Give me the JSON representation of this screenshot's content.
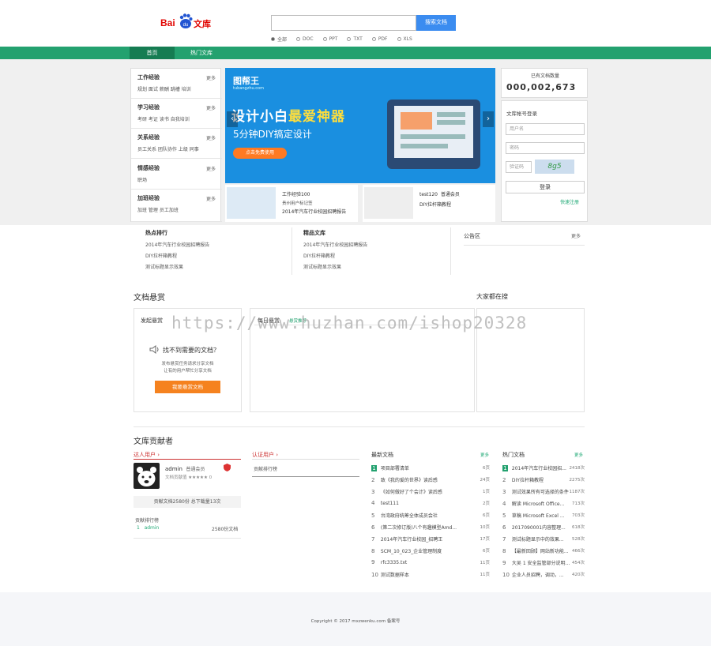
{
  "header": {
    "logo_bai": "Bai",
    "logo_du": "du",
    "logo_wenku": "文库",
    "search_placeholder": "",
    "search_button": "搜索文档",
    "filters": [
      {
        "label": "全部",
        "selected": true
      },
      {
        "label": "DOC",
        "selected": false
      },
      {
        "label": "PPT",
        "selected": false
      },
      {
        "label": "TXT",
        "selected": false
      },
      {
        "label": "PDF",
        "selected": false
      },
      {
        "label": "XLS",
        "selected": false
      }
    ]
  },
  "nav": {
    "items": [
      "首页",
      "热门文库"
    ]
  },
  "categories": [
    {
      "title": "工作经验",
      "more": "更多",
      "links": "规划 面试 薪酬 跳槽 培训"
    },
    {
      "title": "学习经验",
      "more": "更多",
      "links": "考研 考证 读书 自我培训"
    },
    {
      "title": "关系经验",
      "more": "更多",
      "links": "员工关系 团队协作 上级 同事"
    },
    {
      "title": "情感经验",
      "more": "更多",
      "links": "职场"
    },
    {
      "title": "加班经验",
      "more": "更多",
      "links": "加班 管理 员工加班"
    }
  ],
  "banner": {
    "brand": "图帮王",
    "url": "tubangzhu.com",
    "headline_a": "设计小白",
    "headline_b": "最爱神器",
    "subline": "5分钟DIY搞定设计",
    "cta": "点击免费使用",
    "prev": "‹",
    "next": "›"
  },
  "thumbs": [
    {
      "user": "工作经验100",
      "sub": "贵州用户标记签",
      "title": "2014年汽车行业校园招聘报告"
    },
    {
      "user": "test120",
      "sub": "普通会员",
      "title": "DIY拉杆箱教程"
    }
  ],
  "counter": {
    "caption": "已有文档数量",
    "value": "000,002,673"
  },
  "login": {
    "caption": "文库帐号登录",
    "user_placeholder": "用户名",
    "pass_placeholder": "密码",
    "code_placeholder": "验证码",
    "captcha": "8g5",
    "button": "登录",
    "forgot": "快速注册"
  },
  "hot": {
    "title": "热点排行",
    "links": [
      "2014年汽车行业校园招聘报告",
      "DIY拉杆箱教程",
      "测试标题显示效果"
    ]
  },
  "featured": {
    "title": "精品文库",
    "links": [
      "2014年汽车行业校园招聘报告",
      "DIY拉杆箱教程",
      "测试标题显示效果"
    ]
  },
  "notice": {
    "title": "公告区",
    "more": "更多"
  },
  "reward": {
    "title": "文档悬赏",
    "col1_label": "发起悬赏",
    "question": "找不到需要的文档？",
    "desc1": "发布悬赏任务请求分享文档",
    "desc2": "让有的用户帮忙分享文档",
    "button": "我要悬赏文档",
    "col2_label": "每日悬赏",
    "col2_tab": "悬赏推荐",
    "col3_label": "大家都在搜"
  },
  "contrib": {
    "title": "文库贡献者",
    "expert": "达人用户",
    "certified": "认证用户",
    "certified_tab": "贡献排行榜",
    "latest": "最新文档",
    "latest_more": "更多",
    "hotdocs": "热门文档",
    "hotdocs_more": "更多",
    "user_name": "admin",
    "user_level": "普通会员",
    "user_stars": "文档贡献值 ★★★★★ 0",
    "stats": "贡献文档2580份 总下载量13次",
    "rank_title": "贡献排行榜",
    "rank": [
      {
        "n": "1",
        "name": "admin",
        "val": "2580份文档"
      }
    ]
  },
  "latest": [
    {
      "n": "1",
      "t": "项目部署清单",
      "v": "6页"
    },
    {
      "n": "2",
      "t": "致《我的爱的世界》读后感",
      "v": "24页"
    },
    {
      "n": "3",
      "t": "《如何做好了个会计》读后感",
      "v": "1页"
    },
    {
      "n": "4",
      "t": "test111",
      "v": "2页"
    },
    {
      "n": "5",
      "t": "台湾政府统筹全体成员会社",
      "v": "6页"
    },
    {
      "n": "6",
      "t": "(第二次修订版)八个有趣模型Amd...",
      "v": "10页"
    },
    {
      "n": "7",
      "t": "2014年汽车行业校园_招聘王",
      "v": "17页"
    },
    {
      "n": "8",
      "t": "SCM_10_023_企业管理制度",
      "v": "6页"
    },
    {
      "n": "9",
      "t": "rfc3335.txt",
      "v": "11页"
    },
    {
      "n": "10",
      "t": "测试数据样本",
      "v": "11页"
    }
  ],
  "hotdocs": [
    {
      "n": "1",
      "t": "2014年汽车行业校园招...",
      "v": "2418次"
    },
    {
      "n": "2",
      "t": "DIY拉杆箱教程",
      "v": "2275次"
    },
    {
      "n": "3",
      "t": "测试效果所有可选择的条件",
      "v": "1187次"
    },
    {
      "n": "4",
      "t": "解读 Microsoft Office...",
      "v": "713次"
    },
    {
      "n": "5",
      "t": "草稿 Microsoft Excel ...",
      "v": "703次"
    },
    {
      "n": "6",
      "t": "2017090001内容整理...",
      "v": "618次"
    },
    {
      "n": "7",
      "t": "测试标题显示中的效果...",
      "v": "528次"
    },
    {
      "n": "8",
      "t": "【最新回顾】网站新功能...",
      "v": "466次"
    },
    {
      "n": "9",
      "t": "大吴 1 安全监管部分说明...",
      "v": "454次"
    },
    {
      "n": "10",
      "t": "企业人员招聘，调动，...",
      "v": "420次"
    }
  ],
  "footer": {
    "text": "Copyright © 2017 mxzwenku.com 备案号"
  },
  "watermark": "https://www.huzhan.com/ishop20328"
}
